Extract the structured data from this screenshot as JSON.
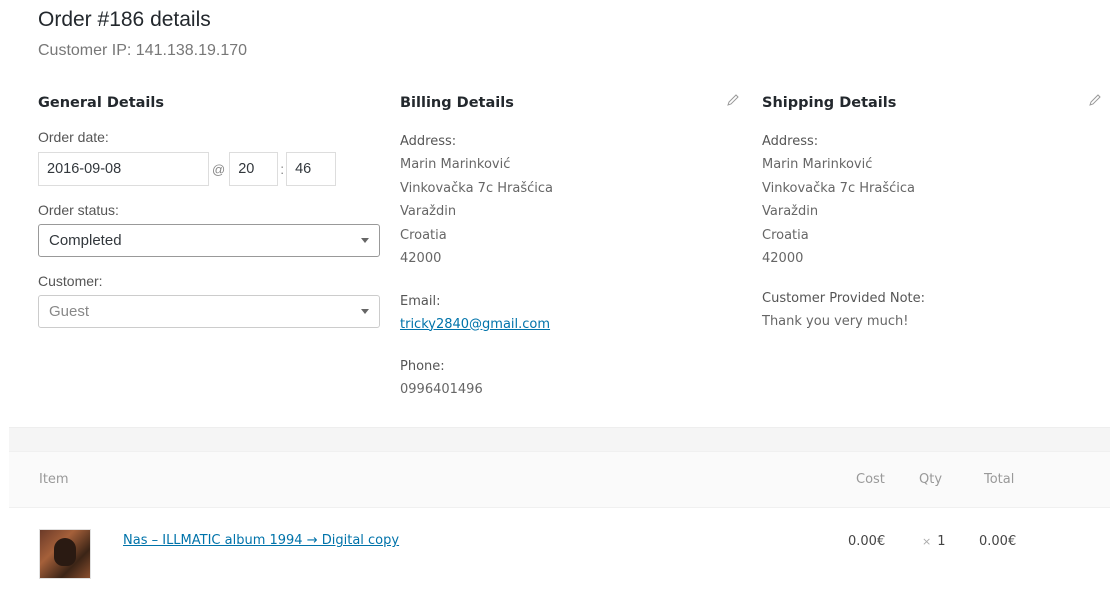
{
  "header": {
    "title": "Order #186 details",
    "customer_ip": "Customer IP: 141.138.19.170"
  },
  "general": {
    "heading": "General Details",
    "order_date_label": "Order date:",
    "order_date": "2016-09-08",
    "at_sign": "@",
    "hour": "20",
    "colon": ":",
    "minute": "46",
    "order_status_label": "Order status:",
    "order_status": "Completed",
    "customer_label": "Customer:",
    "customer": "Guest"
  },
  "billing": {
    "heading": "Billing Details",
    "address_label": "Address:",
    "address": [
      "Marin Marinković",
      "Vinkovačka 7c Hrašćica",
      "Varaždin",
      "Croatia",
      "42000"
    ],
    "email_label": "Email:",
    "email": "tricky2840@gmail.com",
    "phone_label": "Phone:",
    "phone": "0996401496"
  },
  "shipping": {
    "heading": "Shipping Details",
    "address_label": "Address:",
    "address": [
      "Marin Marinković",
      "Vinkovačka 7c Hrašćica",
      "Varaždin",
      "Croatia",
      "42000"
    ],
    "note_label": "Customer Provided Note:",
    "note": "Thank you very much!"
  },
  "items_table": {
    "columns": {
      "item": "Item",
      "cost": "Cost",
      "qty": "Qty",
      "total": "Total"
    },
    "rows": [
      {
        "name": "Nas – ILLMATIC album 1994 → Digital copy",
        "cost": "0.00€",
        "qty_prefix": "×",
        "qty": "1",
        "total": "0.00€"
      }
    ]
  },
  "icons": {
    "edit": "pencil-icon",
    "dropdown": "chevron-down-icon"
  },
  "colors": {
    "link": "#0073aa",
    "heading": "#23282d"
  }
}
